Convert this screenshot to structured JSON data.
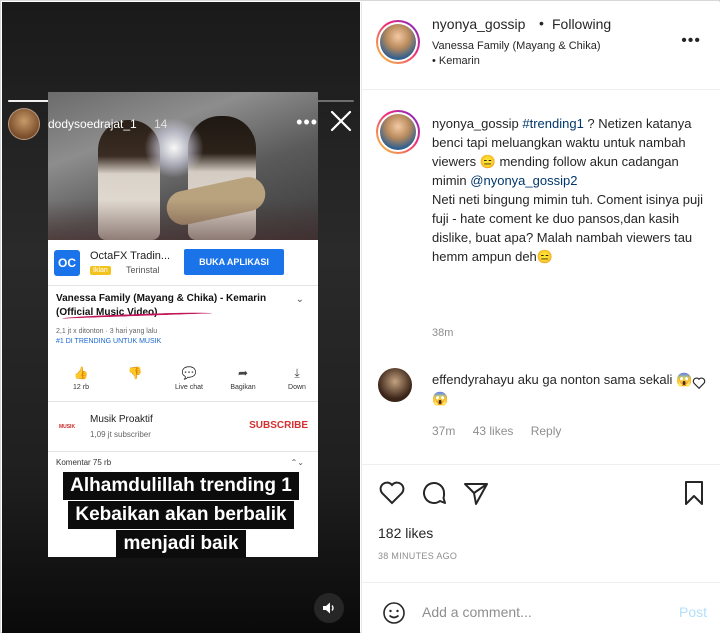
{
  "story": {
    "username": "dodysoedrajat_1",
    "time": "14",
    "progress": 0.7,
    "ad": {
      "logo_text": "OC",
      "name": "OctaFX Tradin...",
      "badge": "Iklan",
      "installed": "Terinstal",
      "cta": "BUKA APLIKASI"
    },
    "video": {
      "title": "Vanessa Family (Mayang & Chika) - Kemarin (Official Music Video)",
      "meta": "2,1 jt x ditonton · 3 hari yang lalu",
      "trending": "#1 DI TRENDING UNTUK MUSIK"
    },
    "actions": [
      {
        "icon": "thumbs-up-icon",
        "glyph": "👍",
        "label": "12 rb"
      },
      {
        "icon": "thumbs-down-icon",
        "glyph": "👎",
        "label": ""
      },
      {
        "icon": "live-chat-icon",
        "glyph": "💬",
        "label": "Live chat"
      },
      {
        "icon": "share-icon",
        "glyph": "➦",
        "label": "Bagikan"
      },
      {
        "icon": "download-icon",
        "glyph": "⤓",
        "label": "Down"
      }
    ],
    "channel": {
      "logo_text": "MUSIK",
      "name": "Musik Proaktif",
      "subscribers": "1,09 jt subscriber",
      "subscribe": "SUBSCRIBE"
    },
    "comments_label": "Komentar  75 rb",
    "caption_lines": [
      "Alhamdulillah trending 1",
      "Kebaikan akan berbalik",
      "menjadi baik"
    ]
  },
  "post": {
    "username": "nyonya_gossip",
    "follow_status": "Following",
    "song": "Vanessa Family (Mayang & Chika) • Kemarin",
    "caption_user": "nyonya_gossip",
    "caption_tag": "#trending1",
    "caption_part1": " ? Netizen katanya benci tapi meluangkan waktu untuk nambah viewers 😑 mending follow akun cadangan mimin ",
    "caption_mention": "@nyonya_gossip2",
    "caption_part2": "Neti neti bingung mimin tuh. Coment isinya puji fuji - hate coment ke duo pansos,dan kasih dislike, buat apa? Malah nambah viewers tau hemm ampun deh😑",
    "caption_time": "38m",
    "comment": {
      "username": "effendyrahayu",
      "text": " aku ga nonton sama sekali 😱😱",
      "time": "37m",
      "likes": "43 likes",
      "reply": "Reply"
    },
    "likes": "182 likes",
    "ago": "38 MINUTES AGO",
    "add_comment_placeholder": "Add a comment...",
    "post_button": "Post"
  }
}
